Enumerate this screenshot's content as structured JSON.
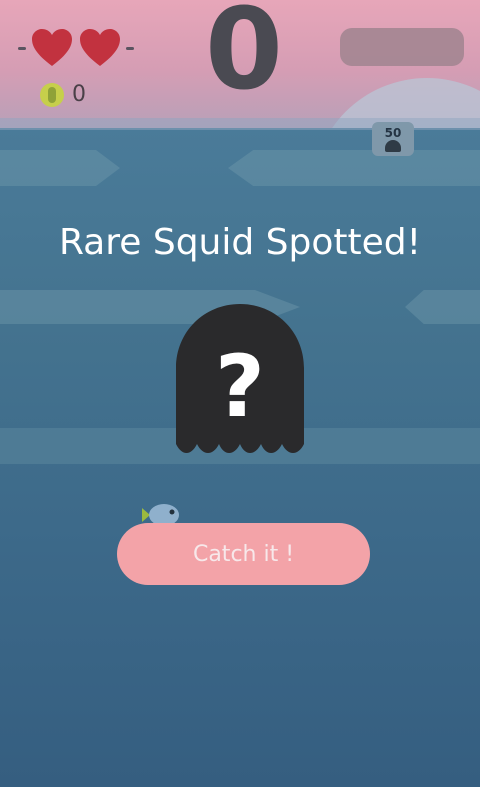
{
  "hud": {
    "lives": 2,
    "heart_color": "#c2323f",
    "coin_count": "0",
    "score": "0",
    "next_badge_value": "50"
  },
  "popup": {
    "title": "Rare Squid Spotted!",
    "mystery_symbol": "?",
    "catch_button_label": "Catch it !"
  },
  "colors": {
    "sky_top": "#e7a6b9",
    "water": "#44738f",
    "button": "#f3a3a8",
    "mystery_squid": "#2a2a2c"
  },
  "icons": [
    "heart-icon",
    "coin-icon",
    "ghost-icon",
    "mystery-squid-icon",
    "fish-icon"
  ]
}
